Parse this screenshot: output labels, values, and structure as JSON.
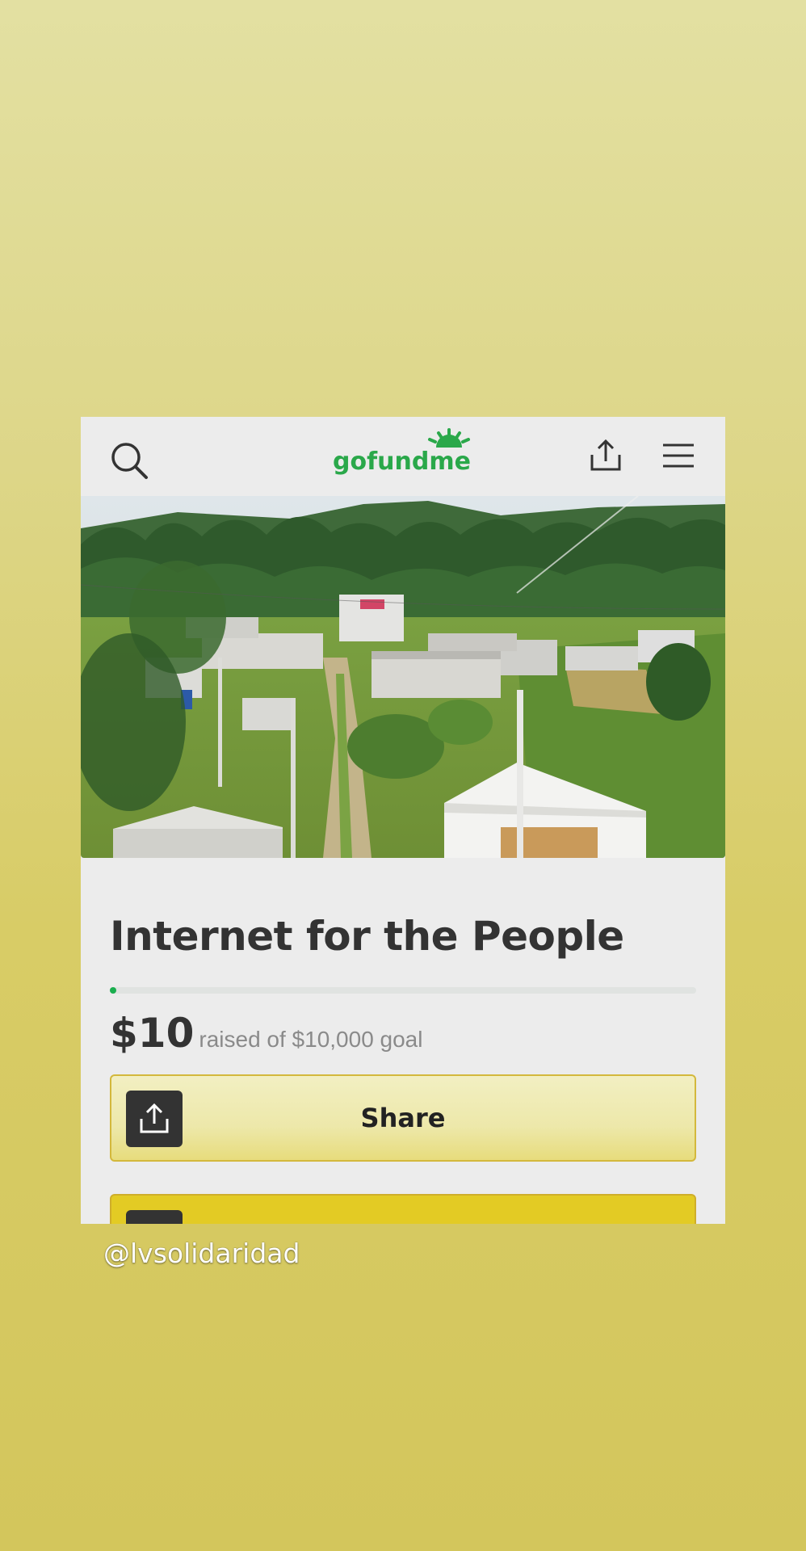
{
  "brand": {
    "logo_text": "gofundme",
    "accent_color": "#2aa84a"
  },
  "header": {
    "search_icon": "search-icon",
    "share_icon": "share-upload-icon",
    "menu_icon": "hamburger-menu-icon"
  },
  "hero": {
    "image_subject": "hillside village with small houses, dirt path and pine forest"
  },
  "campaign": {
    "title": "Internet for the People",
    "amount_raised": "$10",
    "goal_text": "raised of $10,000 goal",
    "progress_fraction": 0.001
  },
  "actions": {
    "share_label": "Share",
    "share_icon": "share-upload-icon",
    "donate_icon": "donate-icon"
  },
  "overlay": {
    "handle": "@lvsolidaridad"
  },
  "colors": {
    "progress": "#1aae4e",
    "share_button": "#ede8aa",
    "donate_button": "#e3cb24",
    "title_text": "#333333"
  }
}
